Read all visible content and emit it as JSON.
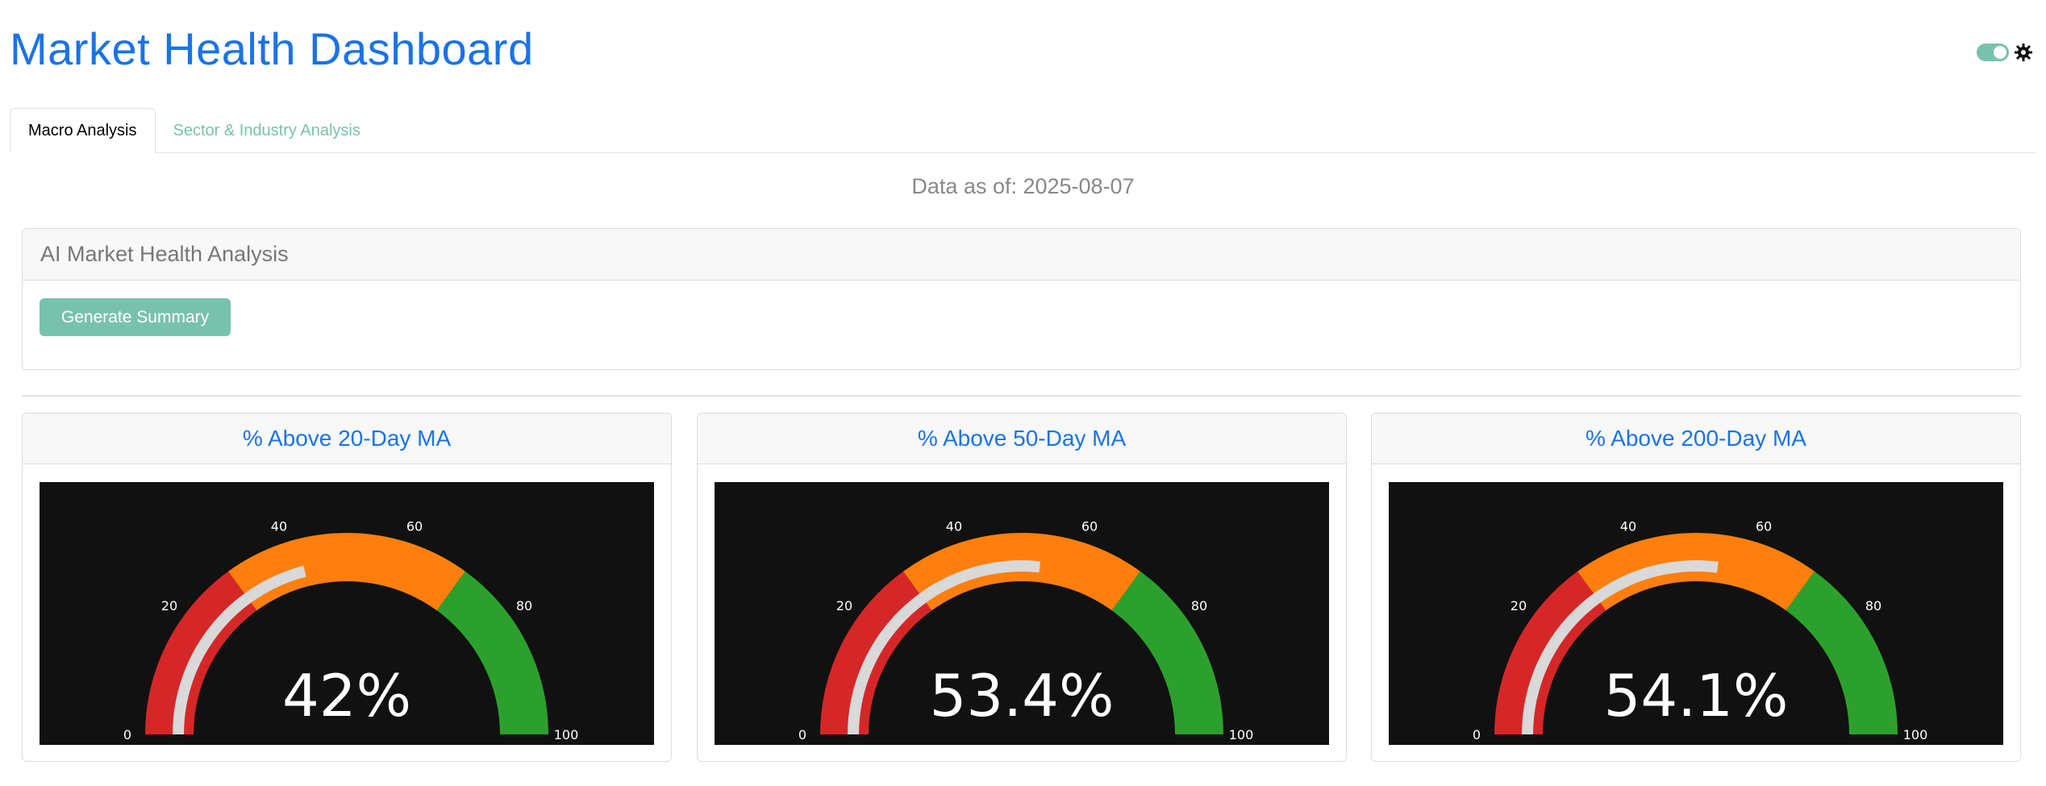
{
  "header": {
    "title": "Market Health Dashboard"
  },
  "tabs": [
    {
      "label": "Macro Analysis",
      "active": true
    },
    {
      "label": "Sector & Industry Analysis",
      "active": false
    }
  ],
  "data_asof": "Data as of: 2025-08-07",
  "ai_card": {
    "title": "AI Market Health Analysis",
    "button_label": "Generate Summary"
  },
  "colors": {
    "accent": "#1a73e8",
    "button": "#78c2ad",
    "red": "#d62728",
    "orange": "#ff7f0e",
    "green": "#2ca02c",
    "bar": "#d9d9d9",
    "plot_bg": "#111111"
  },
  "gauges": [
    {
      "title": "% Above 20-Day MA",
      "value": 42,
      "display": "42%"
    },
    {
      "title": "% Above 50-Day MA",
      "value": 53.4,
      "display": "53.4%"
    },
    {
      "title": "% Above 200-Day MA",
      "value": 54.1,
      "display": "54.1%"
    }
  ],
  "gauge_axis": {
    "min": 0,
    "max": 100,
    "ticks": [
      "0",
      "20",
      "40",
      "60",
      "80",
      "100"
    ]
  },
  "gauge_steps": [
    {
      "from": 0,
      "to": 30,
      "color": "#d62728"
    },
    {
      "from": 30,
      "to": 70,
      "color": "#ff7f0e"
    },
    {
      "from": 70,
      "to": 100,
      "color": "#2ca02c"
    }
  ]
}
